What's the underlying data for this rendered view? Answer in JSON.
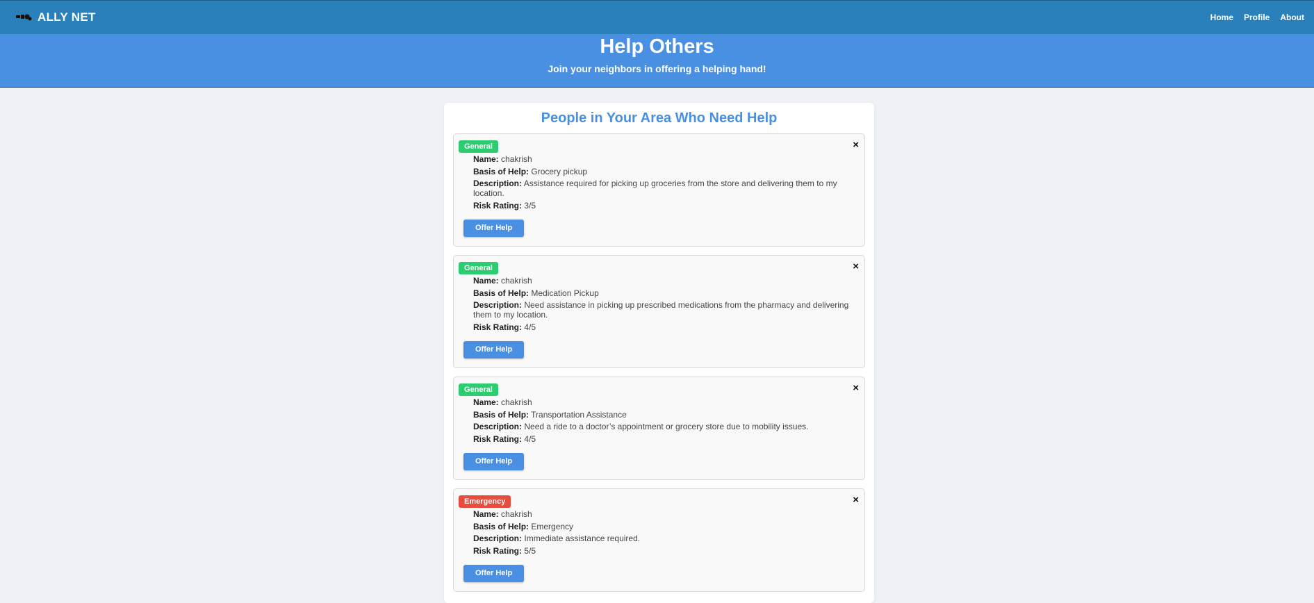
{
  "nav": {
    "brand": "ALLY NET",
    "links": [
      "Home",
      "Profile",
      "About"
    ]
  },
  "hero": {
    "title": "Help Others",
    "subtitle": "Join your neighbors in offering a helping hand!"
  },
  "main": {
    "title": "People in Your Area Who Need Help",
    "labels": {
      "name": "Name:",
      "basis": "Basis of Help:",
      "description": "Description:",
      "risk": "Risk Rating:",
      "offer": "Offer Help",
      "close": "×"
    },
    "requests": [
      {
        "category": "General",
        "category_color": "#2ecc71",
        "name": "chakrish",
        "basis": "Grocery pickup",
        "description": "Assistance required for picking up groceries from the store and delivering them to my location.",
        "risk": "3/5"
      },
      {
        "category": "General",
        "category_color": "#2ecc71",
        "name": "chakrish",
        "basis": "Medication Pickup",
        "description": "Need assistance in picking up prescribed medications from the pharmacy and delivering them to my location.",
        "risk": "4/5"
      },
      {
        "category": "General",
        "category_color": "#2ecc71",
        "name": "chakrish",
        "basis": "Transportation Assistance",
        "description": "Need a ride to a doctor’s appointment or grocery store due to mobility issues.",
        "risk": "4/5"
      },
      {
        "category": "Emergency",
        "category_color": "#e74c3c",
        "name": "chakrish",
        "basis": "Emergency",
        "description": "Immediate assistance required.",
        "risk": "5/5"
      }
    ]
  }
}
